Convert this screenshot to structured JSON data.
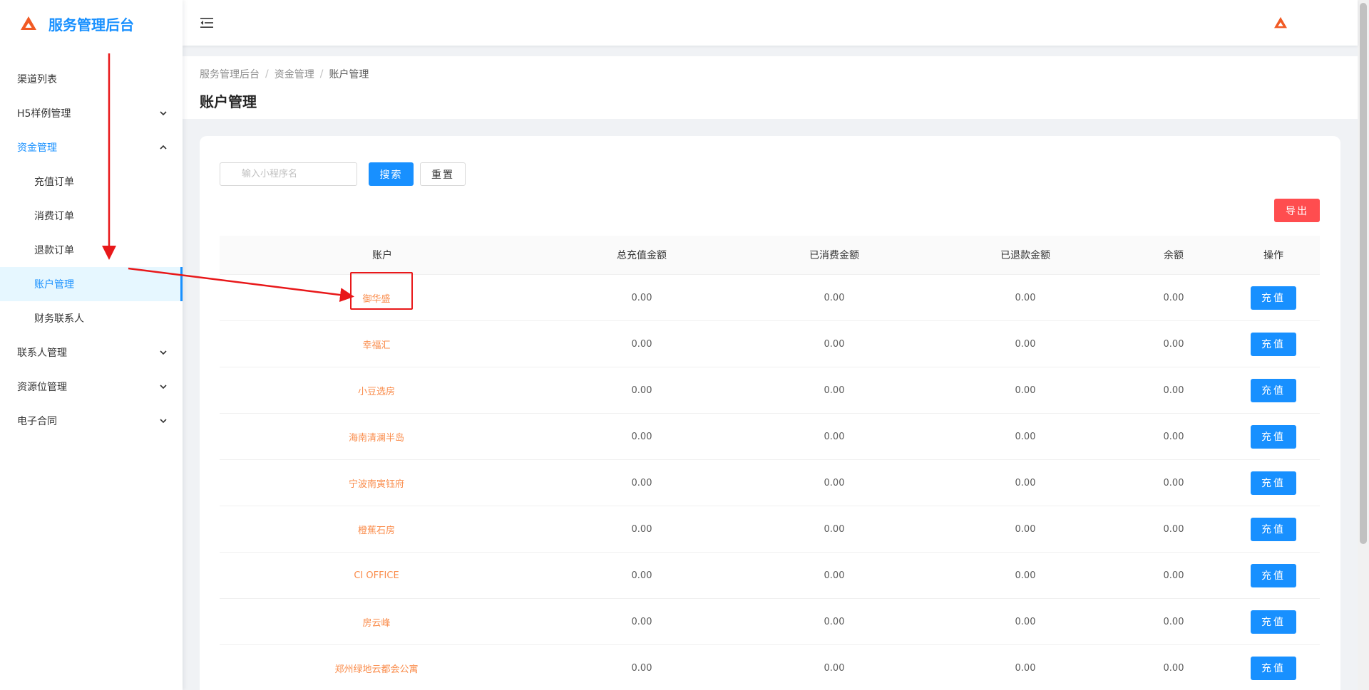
{
  "sidebar": {
    "brand_title": "服务管理后台",
    "items": [
      {
        "label": "渠道列表"
      },
      {
        "label": "H5样例管理"
      },
      {
        "label": "资金管理"
      },
      {
        "label": "充值订单"
      },
      {
        "label": "消费订单"
      },
      {
        "label": "退款订单"
      },
      {
        "label": "账户管理"
      },
      {
        "label": "财务联系人"
      },
      {
        "label": "联系人管理"
      },
      {
        "label": "资源位管理"
      },
      {
        "label": "电子合同"
      }
    ],
    "active_item": "账户管理"
  },
  "breadcrumb": [
    "服务管理后台",
    "资金管理",
    "账户管理"
  ],
  "breadcrumb_separator": "/",
  "page_title": "账户管理",
  "search": {
    "placeholder": "输入小程序名",
    "search_label": "搜索",
    "reset_label": "重置"
  },
  "export_label": "导出",
  "table": {
    "headers": {
      "account": "账户",
      "total": "总充值金额",
      "spent": "已消费金额",
      "refund": "已退款金额",
      "balance": "余额",
      "action": "操作"
    },
    "action_label": "充值",
    "rows": [
      {
        "account": "御华盛",
        "total": "0.00",
        "spent": "0.00",
        "refund": "0.00",
        "balance": "0.00"
      },
      {
        "account": "幸福汇",
        "total": "0.00",
        "spent": "0.00",
        "refund": "0.00",
        "balance": "0.00"
      },
      {
        "account": "小豆选房",
        "total": "0.00",
        "spent": "0.00",
        "refund": "0.00",
        "balance": "0.00"
      },
      {
        "account": "海南清澜半岛",
        "total": "0.00",
        "spent": "0.00",
        "refund": "0.00",
        "balance": "0.00"
      },
      {
        "account": "宁波南寅钰府",
        "total": "0.00",
        "spent": "0.00",
        "refund": "0.00",
        "balance": "0.00"
      },
      {
        "account": "橙蕉石房",
        "total": "0.00",
        "spent": "0.00",
        "refund": "0.00",
        "balance": "0.00"
      },
      {
        "account": "CI OFFICE",
        "total": "0.00",
        "spent": "0.00",
        "refund": "0.00",
        "balance": "0.00"
      },
      {
        "account": "房云峰",
        "total": "0.00",
        "spent": "0.00",
        "refund": "0.00",
        "balance": "0.00"
      },
      {
        "account": "郑州绿地云都会公寓",
        "total": "0.00",
        "spent": "0.00",
        "refund": "0.00",
        "balance": "0.00"
      }
    ]
  },
  "icons": {
    "brand": "logo-triangle-icon",
    "fold": "menu-fold-icon",
    "chevron": "chevron-icon",
    "header_logo": "logo-triangle-icon"
  },
  "colors": {
    "primary": "#1890ff",
    "danger": "#ff4d4f",
    "account_link": "#fa8c4b",
    "logo": "#f15a24",
    "annotation": "#e8181a"
  }
}
